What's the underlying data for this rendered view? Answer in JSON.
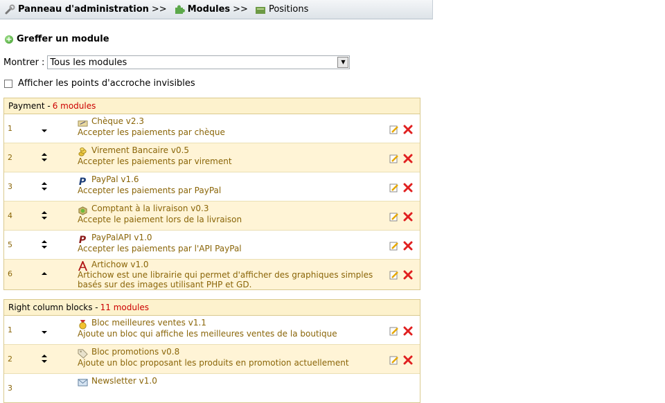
{
  "breadcrumb": {
    "root": "Panneau d'administration",
    "sep1": ">>",
    "modules": "Modules",
    "sep2": ">>",
    "current": "Positions"
  },
  "add_module": "Greffer un module",
  "filter": {
    "label": "Montrer :",
    "value": "Tous les modules"
  },
  "invisible_hooks_label": "Afficher les points d'accroche invisibles",
  "sections": [
    {
      "title": "Payment -",
      "count": "6 modules",
      "rows": [
        {
          "pos": "1",
          "name": "Chèque v2.3",
          "desc": "Accepter les paiements par chèque"
        },
        {
          "pos": "2",
          "name": "Virement Bancaire v0.5",
          "desc": "Accepter les paiements par virement"
        },
        {
          "pos": "3",
          "name": "PayPal v1.6",
          "desc": "Accepter les paiements par PayPal"
        },
        {
          "pos": "4",
          "name": "Comptant à la livraison v0.3",
          "desc": "Accepte le paiement lors de la livraison"
        },
        {
          "pos": "5",
          "name": "PayPalAPI v1.0",
          "desc": "Accepter les paiements par l'API PayPal"
        },
        {
          "pos": "6",
          "name": "Artichow v1.0",
          "desc": "Artichow est une librairie qui permet d'afficher des graphiques simples basés sur des images utilisant PHP et GD."
        }
      ]
    },
    {
      "title": "Right column blocks -",
      "count": "11 modules",
      "rows": [
        {
          "pos": "1",
          "name": "Bloc meilleures ventes v1.1",
          "desc": "Ajoute un bloc qui affiche les meilleures ventes de la boutique"
        },
        {
          "pos": "2",
          "name": "Bloc promotions v0.8",
          "desc": "Ajoute un bloc proposant les produits en promotion actuellement"
        },
        {
          "pos": "3",
          "name": "Newsletter v1.0",
          "desc": ""
        }
      ]
    }
  ]
}
